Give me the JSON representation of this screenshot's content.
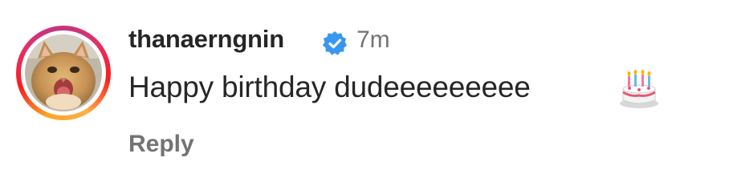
{
  "comment": {
    "username": "thanaerngnin",
    "verified": true,
    "timestamp": "7m",
    "text": "Happy birthday dudeeeeeeeee",
    "emoji": "birthday-cake-icon",
    "reply_label": "Reply"
  },
  "colors": {
    "verified_badge": "#3897f0",
    "secondary_text": "#737373",
    "primary_text": "#262626"
  }
}
